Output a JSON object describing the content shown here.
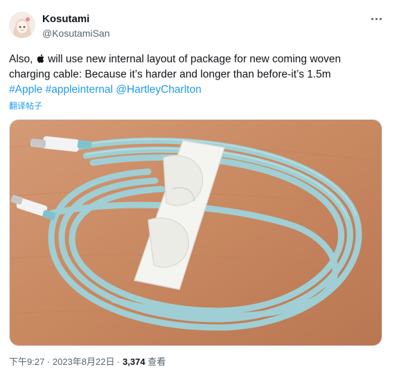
{
  "author": {
    "display_name": "Kosutami",
    "handle": "@KosutamiSan"
  },
  "tweet": {
    "line1_before_logo": "Also,",
    "logo_icon": "apple-logo-icon",
    "line1_after_logo": "will use new internal layout of package for new coming woven",
    "line2": "charging cable: Because it’s harder and longer than before-it’s 1.5m",
    "hashtags": [
      "#Apple",
      "#appleinternal"
    ],
    "mention": "@HartleyCharlton",
    "translate_label": "翻译帖子"
  },
  "media": {
    "icon": "photo-cable-image",
    "colors": {
      "table": "#c98a63",
      "cable": "#a9d4d8",
      "connector": "#f2f2f2",
      "packaging": "#f4f4f0"
    }
  },
  "meta": {
    "time_date": "下午9:27 · 2023年8月22日 · ",
    "views_count": "3,374",
    "views_label": " 查看"
  },
  "colors": {
    "link": "#1d9bf0",
    "secondary_text": "#536471",
    "primary_text": "#0f1419"
  }
}
